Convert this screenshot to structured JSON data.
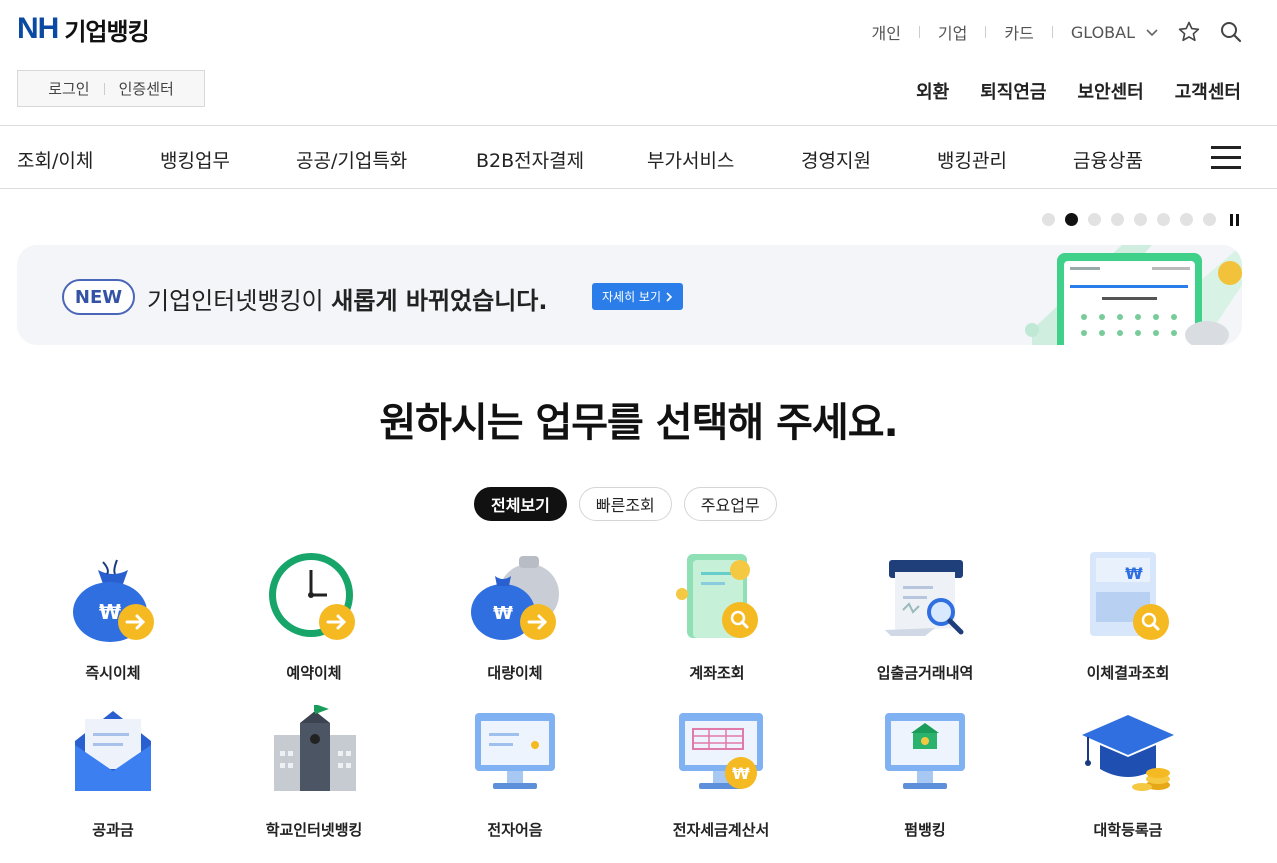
{
  "header": {
    "logo_mark": "NH",
    "logo_text": "기업뱅킹",
    "util_links": [
      "개인",
      "기업",
      "카드"
    ],
    "global_label": "GLOBAL",
    "login": "로그인",
    "cert_center": "인증센터",
    "sub_links": [
      "외환",
      "퇴직연금",
      "보안센터",
      "고객센터"
    ]
  },
  "gnb": [
    "조회/이체",
    "뱅킹업무",
    "공공/기업특화",
    "B2B전자결제",
    "부가서비스",
    "경영지원",
    "뱅킹관리",
    "금융상품"
  ],
  "banner": {
    "badge": "NEW",
    "text_prefix": "기업인터넷뱅킹이 ",
    "text_bold": "새롭게 바뀌었습니다.",
    "detail_button": "자세히 보기",
    "active_slide": 2,
    "slide_count": 8
  },
  "main": {
    "title": "원하시는 업무를 선택해 주세요.",
    "tabs": [
      "전체보기",
      "빠른조회",
      "주요업무"
    ],
    "active_tab": "전체보기",
    "services": [
      {
        "label": "즉시이체",
        "icon": "money-bag-transfer-icon"
      },
      {
        "label": "예약이체",
        "icon": "clock-transfer-icon"
      },
      {
        "label": "대량이체",
        "icon": "multiple-money-bags-transfer-icon"
      },
      {
        "label": "계좌조회",
        "icon": "account-book-search-icon"
      },
      {
        "label": "입출금거래내역",
        "icon": "receipt-search-icon"
      },
      {
        "label": "이체결과조회",
        "icon": "document-search-icon"
      },
      {
        "label": "공과금",
        "icon": "envelope-bill-icon"
      },
      {
        "label": "학교인터넷뱅킹",
        "icon": "school-building-icon"
      },
      {
        "label": "전자어음",
        "icon": "monitor-note-icon"
      },
      {
        "label": "전자세금계산서",
        "icon": "monitor-tax-invoice-icon"
      },
      {
        "label": "펌뱅킹",
        "icon": "monitor-bank-icon"
      },
      {
        "label": "대학등록금",
        "icon": "graduation-cap-coins-icon"
      }
    ]
  },
  "colors": {
    "brand_blue": "#0a4aa3",
    "accent_blue": "#2b7de9",
    "arrow_yellow": "#f5b921"
  }
}
